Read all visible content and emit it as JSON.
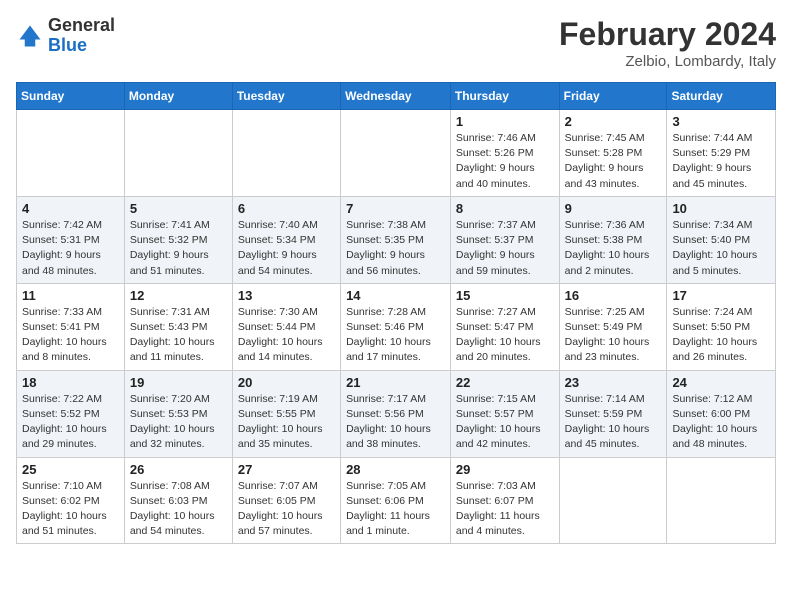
{
  "header": {
    "logo": {
      "line1": "General",
      "line2": "Blue"
    },
    "title": "February 2024",
    "location": "Zelbio, Lombardy, Italy"
  },
  "weekdays": [
    "Sunday",
    "Monday",
    "Tuesday",
    "Wednesday",
    "Thursday",
    "Friday",
    "Saturday"
  ],
  "weeks": [
    [
      {
        "day": "",
        "info": ""
      },
      {
        "day": "",
        "info": ""
      },
      {
        "day": "",
        "info": ""
      },
      {
        "day": "",
        "info": ""
      },
      {
        "day": "1",
        "info": "Sunrise: 7:46 AM\nSunset: 5:26 PM\nDaylight: 9 hours\nand 40 minutes."
      },
      {
        "day": "2",
        "info": "Sunrise: 7:45 AM\nSunset: 5:28 PM\nDaylight: 9 hours\nand 43 minutes."
      },
      {
        "day": "3",
        "info": "Sunrise: 7:44 AM\nSunset: 5:29 PM\nDaylight: 9 hours\nand 45 minutes."
      }
    ],
    [
      {
        "day": "4",
        "info": "Sunrise: 7:42 AM\nSunset: 5:31 PM\nDaylight: 9 hours\nand 48 minutes."
      },
      {
        "day": "5",
        "info": "Sunrise: 7:41 AM\nSunset: 5:32 PM\nDaylight: 9 hours\nand 51 minutes."
      },
      {
        "day": "6",
        "info": "Sunrise: 7:40 AM\nSunset: 5:34 PM\nDaylight: 9 hours\nand 54 minutes."
      },
      {
        "day": "7",
        "info": "Sunrise: 7:38 AM\nSunset: 5:35 PM\nDaylight: 9 hours\nand 56 minutes."
      },
      {
        "day": "8",
        "info": "Sunrise: 7:37 AM\nSunset: 5:37 PM\nDaylight: 9 hours\nand 59 minutes."
      },
      {
        "day": "9",
        "info": "Sunrise: 7:36 AM\nSunset: 5:38 PM\nDaylight: 10 hours\nand 2 minutes."
      },
      {
        "day": "10",
        "info": "Sunrise: 7:34 AM\nSunset: 5:40 PM\nDaylight: 10 hours\nand 5 minutes."
      }
    ],
    [
      {
        "day": "11",
        "info": "Sunrise: 7:33 AM\nSunset: 5:41 PM\nDaylight: 10 hours\nand 8 minutes."
      },
      {
        "day": "12",
        "info": "Sunrise: 7:31 AM\nSunset: 5:43 PM\nDaylight: 10 hours\nand 11 minutes."
      },
      {
        "day": "13",
        "info": "Sunrise: 7:30 AM\nSunset: 5:44 PM\nDaylight: 10 hours\nand 14 minutes."
      },
      {
        "day": "14",
        "info": "Sunrise: 7:28 AM\nSunset: 5:46 PM\nDaylight: 10 hours\nand 17 minutes."
      },
      {
        "day": "15",
        "info": "Sunrise: 7:27 AM\nSunset: 5:47 PM\nDaylight: 10 hours\nand 20 minutes."
      },
      {
        "day": "16",
        "info": "Sunrise: 7:25 AM\nSunset: 5:49 PM\nDaylight: 10 hours\nand 23 minutes."
      },
      {
        "day": "17",
        "info": "Sunrise: 7:24 AM\nSunset: 5:50 PM\nDaylight: 10 hours\nand 26 minutes."
      }
    ],
    [
      {
        "day": "18",
        "info": "Sunrise: 7:22 AM\nSunset: 5:52 PM\nDaylight: 10 hours\nand 29 minutes."
      },
      {
        "day": "19",
        "info": "Sunrise: 7:20 AM\nSunset: 5:53 PM\nDaylight: 10 hours\nand 32 minutes."
      },
      {
        "day": "20",
        "info": "Sunrise: 7:19 AM\nSunset: 5:55 PM\nDaylight: 10 hours\nand 35 minutes."
      },
      {
        "day": "21",
        "info": "Sunrise: 7:17 AM\nSunset: 5:56 PM\nDaylight: 10 hours\nand 38 minutes."
      },
      {
        "day": "22",
        "info": "Sunrise: 7:15 AM\nSunset: 5:57 PM\nDaylight: 10 hours\nand 42 minutes."
      },
      {
        "day": "23",
        "info": "Sunrise: 7:14 AM\nSunset: 5:59 PM\nDaylight: 10 hours\nand 45 minutes."
      },
      {
        "day": "24",
        "info": "Sunrise: 7:12 AM\nSunset: 6:00 PM\nDaylight: 10 hours\nand 48 minutes."
      }
    ],
    [
      {
        "day": "25",
        "info": "Sunrise: 7:10 AM\nSunset: 6:02 PM\nDaylight: 10 hours\nand 51 minutes."
      },
      {
        "day": "26",
        "info": "Sunrise: 7:08 AM\nSunset: 6:03 PM\nDaylight: 10 hours\nand 54 minutes."
      },
      {
        "day": "27",
        "info": "Sunrise: 7:07 AM\nSunset: 6:05 PM\nDaylight: 10 hours\nand 57 minutes."
      },
      {
        "day": "28",
        "info": "Sunrise: 7:05 AM\nSunset: 6:06 PM\nDaylight: 11 hours\nand 1 minute."
      },
      {
        "day": "29",
        "info": "Sunrise: 7:03 AM\nSunset: 6:07 PM\nDaylight: 11 hours\nand 4 minutes."
      },
      {
        "day": "",
        "info": ""
      },
      {
        "day": "",
        "info": ""
      }
    ]
  ]
}
